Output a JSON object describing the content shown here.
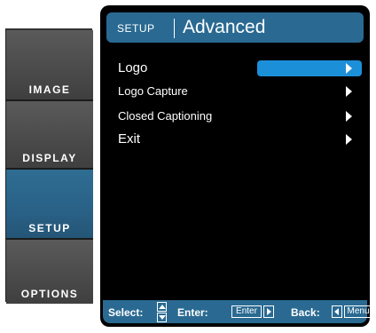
{
  "tabs": [
    {
      "label": "IMAGE",
      "active": false
    },
    {
      "label": "DISPLAY",
      "active": false
    },
    {
      "label": "SETUP",
      "active": true
    },
    {
      "label": "OPTIONS",
      "active": false
    }
  ],
  "header": {
    "breadcrumb": "SETUP",
    "title": "Advanced"
  },
  "menu": {
    "items": [
      {
        "label": "Logo",
        "selected": true,
        "icon": "chevron-right-icon"
      },
      {
        "label": "Logo Capture",
        "selected": false,
        "icon": "chevron-right-icon"
      },
      {
        "label": "Closed Captioning",
        "selected": false,
        "icon": "chevron-right-icon"
      },
      {
        "label": "Exit",
        "selected": false,
        "icon": "chevron-right-icon"
      }
    ]
  },
  "footer": {
    "select_label": "Select:",
    "enter_label": "Enter:",
    "enter_key": "Enter",
    "back_label": "Back:",
    "menu_key": "Menu"
  },
  "colors": {
    "accent": "#2a6a92",
    "selection": "#1c8fd9",
    "active_tab": "#2a6288",
    "inactive_tab": "#4f4f4f",
    "background": "#000000"
  }
}
